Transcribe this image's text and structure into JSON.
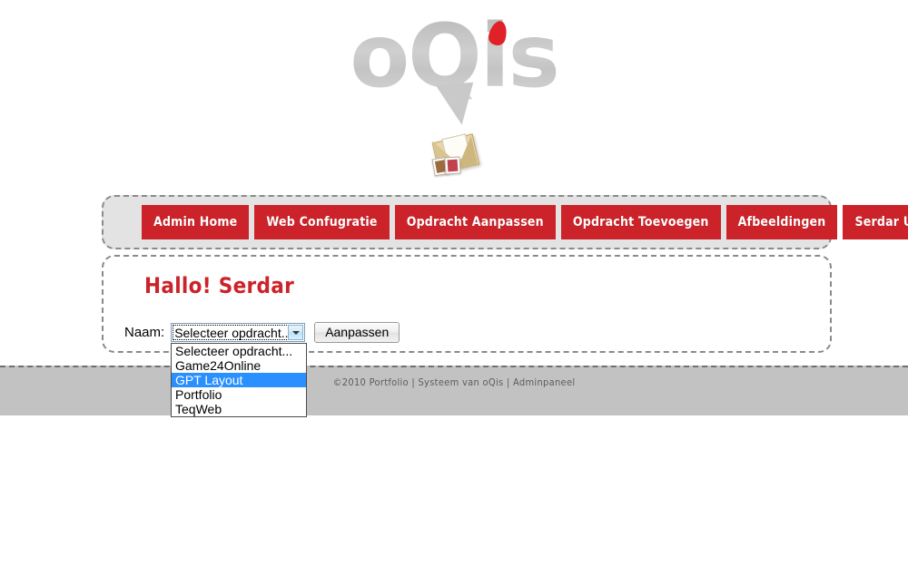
{
  "brand": {
    "logo_text": "oQis",
    "logo_gray": "#c4c4c4",
    "accent_red": "#cc2229",
    "dot_color": "#e02128",
    "envelope_icon": "envelope-with-photos-icon"
  },
  "nav": {
    "items": [
      {
        "label": "Admin Home"
      },
      {
        "label": "Web Confugratie"
      },
      {
        "label": "Opdracht Aanpassen"
      },
      {
        "label": "Opdracht Toevoegen"
      },
      {
        "label": "Afbeeldingen"
      },
      {
        "label": "Serdar Uitloggen?"
      }
    ]
  },
  "main": {
    "greeting": "Hallo! Serdar",
    "form": {
      "name_label": "Naam:",
      "select_value": "Selecteer opdracht...",
      "submit_label": "Aanpassen",
      "arrow_icon": "chevron-down-icon"
    }
  },
  "dropdown": {
    "open": true,
    "highlight_color": "#2a8fff",
    "selected_index": 2,
    "options": [
      {
        "label": "Selecteer opdracht..."
      },
      {
        "label": "Game24Online"
      },
      {
        "label": "GPT Layout"
      },
      {
        "label": "Portfolio"
      },
      {
        "label": "TeqWeb"
      }
    ]
  },
  "footer": {
    "text": "©2010 Portfolio | Systeem van oQis | Adminpaneel",
    "background": "#c2c2c2"
  }
}
